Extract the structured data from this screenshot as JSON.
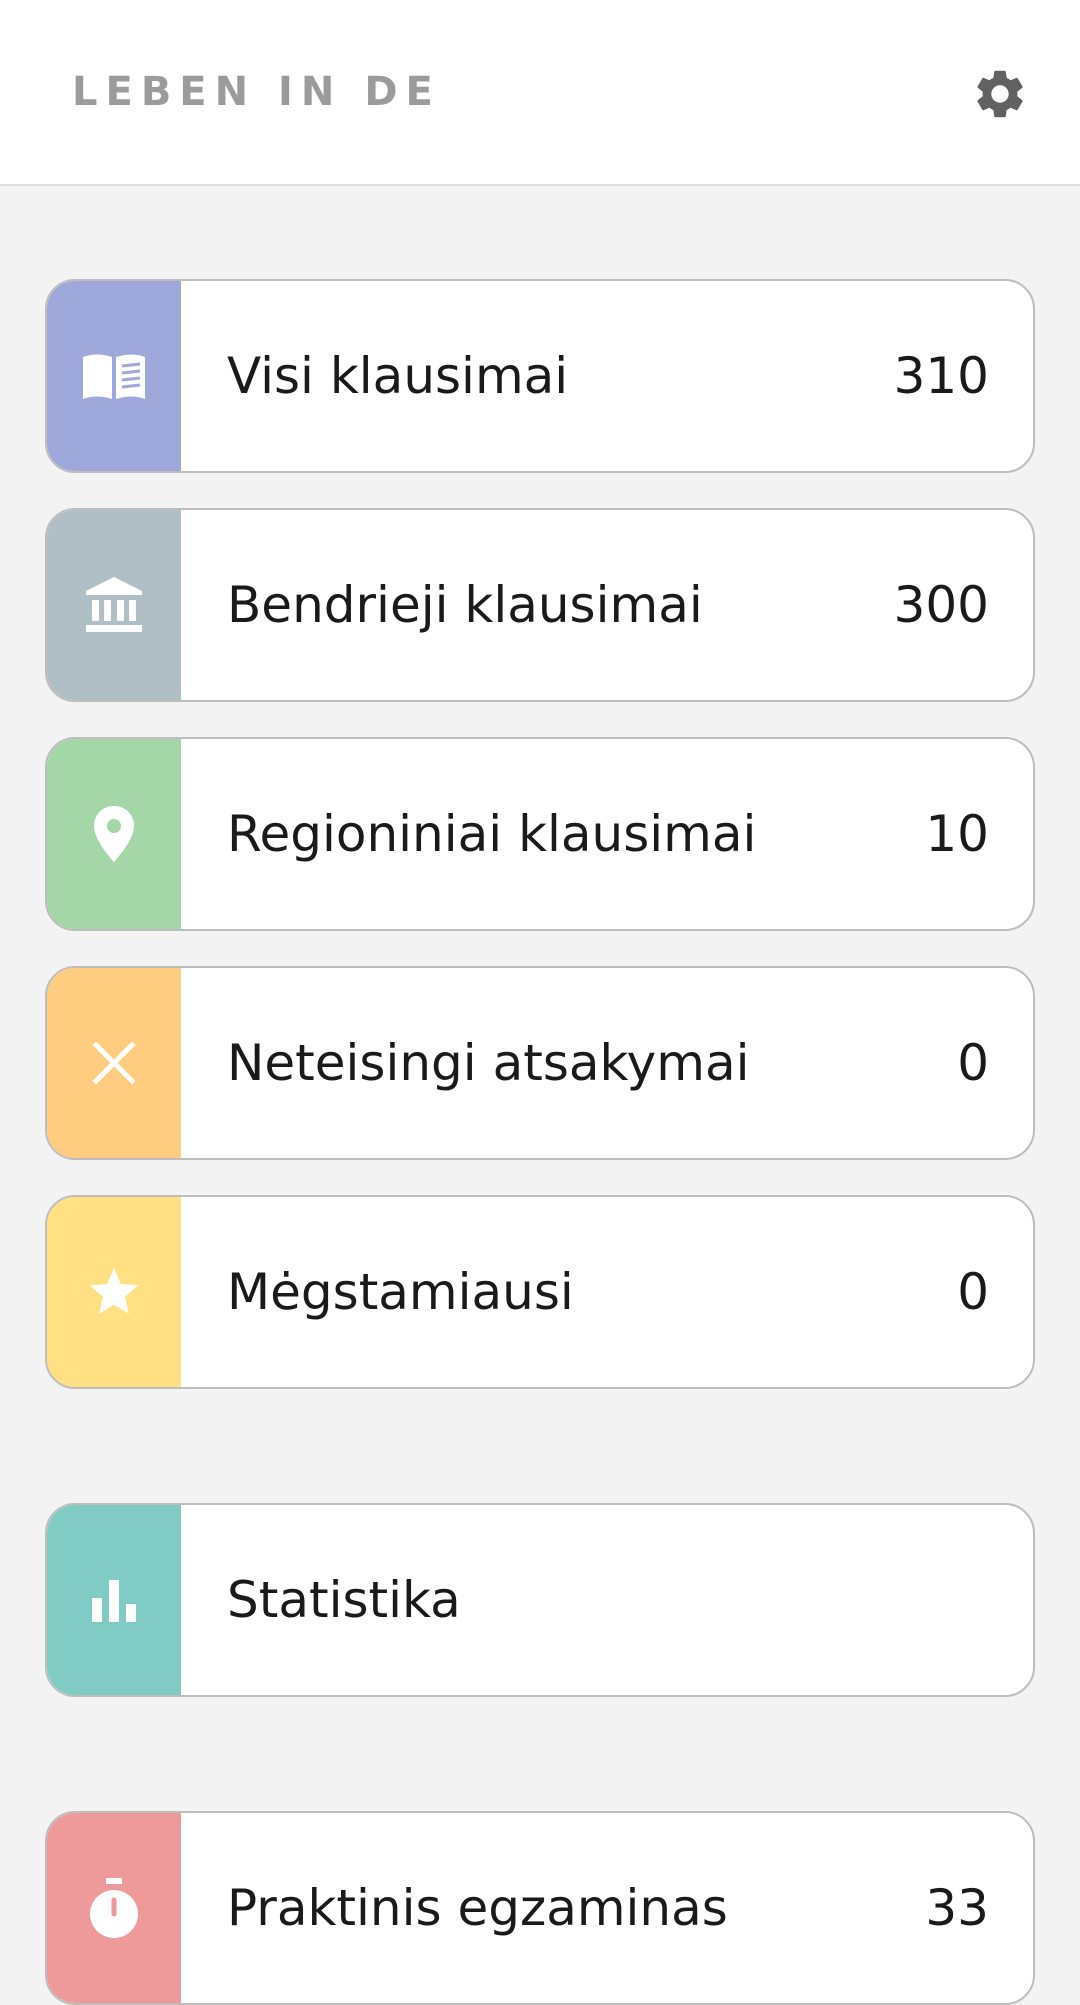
{
  "header": {
    "title": "LEBEN IN DE",
    "settings_icon": "gear-icon"
  },
  "menu": {
    "items": [
      {
        "label": "Visi klausimai",
        "count": "310",
        "icon": "book-icon",
        "color": "#9fa8da"
      },
      {
        "label": "Bendrieji klausimai",
        "count": "300",
        "icon": "institution-icon",
        "color": "#b0bec5"
      },
      {
        "label": "Regioniniai klausimai",
        "count": "10",
        "icon": "location-pin-icon",
        "color": "#a5d6a7"
      },
      {
        "label": "Neteisingi atsakymai",
        "count": "0",
        "icon": "close-icon",
        "color": "#ffcc80"
      },
      {
        "label": "Mėgstamiausi",
        "count": "0",
        "icon": "star-icon",
        "color": "#ffe082"
      }
    ],
    "statistics": {
      "label": "Statistika",
      "icon": "bar-chart-icon",
      "color": "#80cbc4"
    },
    "exam": {
      "label": "Praktinis egzaminas",
      "count": "33",
      "icon": "stopwatch-icon",
      "color": "#ef9a9a"
    }
  }
}
